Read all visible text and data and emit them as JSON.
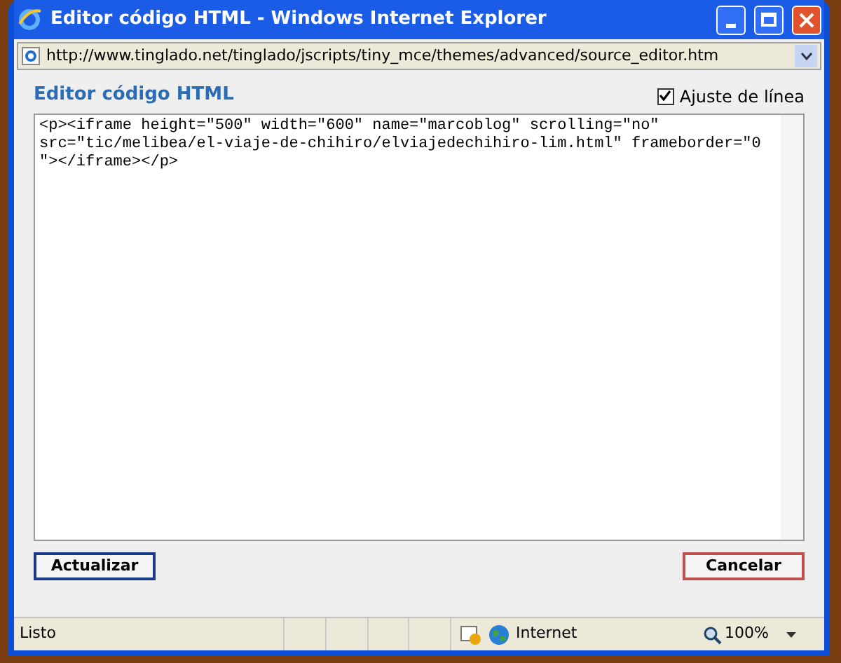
{
  "window": {
    "title": "Editor código HTML - Windows Internet Explorer"
  },
  "address_bar": {
    "url": "http://www.tinglado.net/tinglado/jscripts/tiny_mce/themes/advanced/source_editor.htm"
  },
  "dialog": {
    "heading": "Editor código HTML",
    "word_wrap": {
      "label": "Ajuste de línea",
      "checked": true
    },
    "code_lines": [
      "<p><iframe height=\"500\" width=\"600\" name=\"marcoblog\" scrolling=\"no\"",
      "src=\"tic/melibea/el-viaje-de-chihiro/elviajedechihiro-lim.html\" frameborder=\"0",
      "\"></iframe></p>"
    ],
    "buttons": [
      {
        "label": "Actualizar",
        "kind": "primary"
      },
      {
        "label": "Cancelar",
        "kind": "cancel"
      }
    ]
  },
  "status_bar": {
    "status": "Listo",
    "zone": "Internet",
    "zoom": "100%"
  }
}
